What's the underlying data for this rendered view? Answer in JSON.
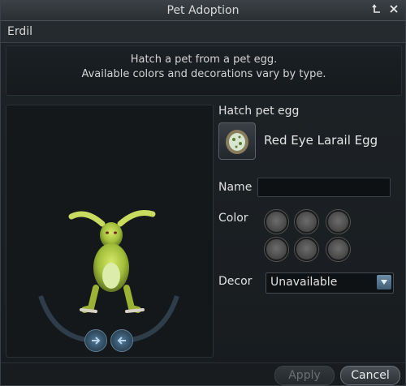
{
  "window": {
    "title": "Pet Adoption"
  },
  "npc": {
    "name": "Erdil"
  },
  "description": {
    "line1": "Hatch a pet from a pet egg.",
    "line2": "Available colors and decorations vary by type."
  },
  "hatch": {
    "label": "Hatch pet egg",
    "egg_name": "Red Eye Larail Egg",
    "egg_icon": "egg-icon"
  },
  "name_field": {
    "label": "Name",
    "value": ""
  },
  "color": {
    "label": "Color",
    "swatch_color": "#5a5a5a"
  },
  "decor": {
    "label": "Decor",
    "value": "Unavailable"
  },
  "buttons": {
    "apply": "Apply",
    "cancel": "Cancel"
  },
  "colors": {
    "accent": "#5a7d99",
    "pet_body": "#a8c43a"
  }
}
